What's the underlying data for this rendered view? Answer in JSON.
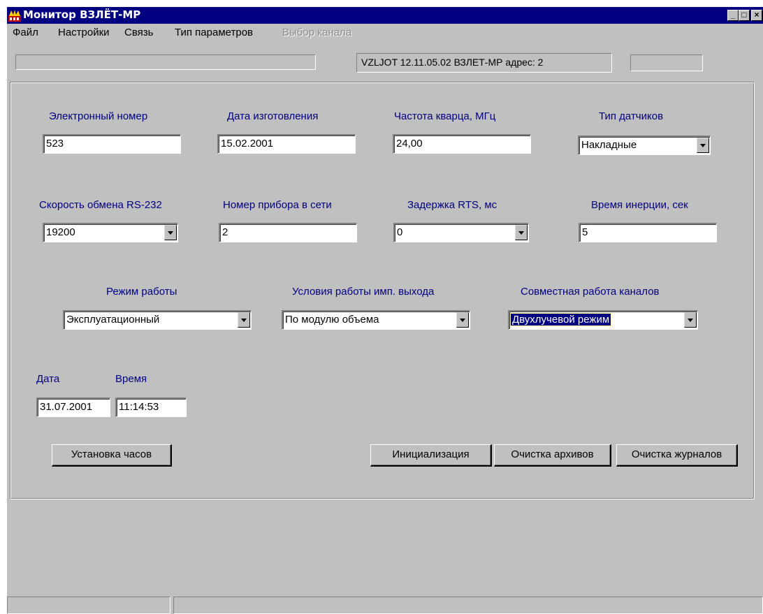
{
  "window": {
    "title": "Монитор ВЗЛЁТ-МР",
    "controls": {
      "minimize": "_",
      "maximize": "□",
      "close": "×"
    }
  },
  "menu": [
    "Файл",
    "Настройки",
    "Связь",
    "Тип параметров",
    "Выбор канала"
  ],
  "toolbar": {
    "device_info": "VZLJOT 12.11.05.02   ВЗЛЕТ-МР адрес:   2"
  },
  "fields": {
    "serial_label": "Электронный номер",
    "serial_value": "523",
    "manufacture_date_label": "Дата изготовления",
    "manufacture_date_value": "15.02.2001",
    "quartz_label": "Частота кварца, МГц",
    "quartz_value": "24,00",
    "sensor_type_label": "Тип датчиков",
    "sensor_type_value": "Накладные",
    "baud_label": "Скорость обмена RS-232",
    "baud_value": "19200",
    "net_number_label": "Номер прибора в сети",
    "net_number_value": "2",
    "rts_label": "Задержка RTS, мс",
    "rts_value": "0",
    "inertia_label": "Время инерции, сек",
    "inertia_value": "5",
    "mode_label": "Режим работы",
    "mode_value": "Эксплуатационный",
    "pulse_label": "Условия работы имп. выхода",
    "pulse_value": "По модулю объема",
    "channels_label": "Совместная работа каналов",
    "channels_value": "Двухлучевой режим",
    "date_label": "Дата",
    "date_value": "31.07.2001",
    "time_label": "Время",
    "time_value": "11:14:53"
  },
  "buttons": {
    "set_clock": "Установка часов",
    "init": "Инициализация",
    "clear_archives": "Очистка архивов",
    "clear_logs": "Очистка журналов"
  },
  "colors": {
    "titlebar": "#000080",
    "label": "#000080",
    "face": "#c0c0c0"
  }
}
